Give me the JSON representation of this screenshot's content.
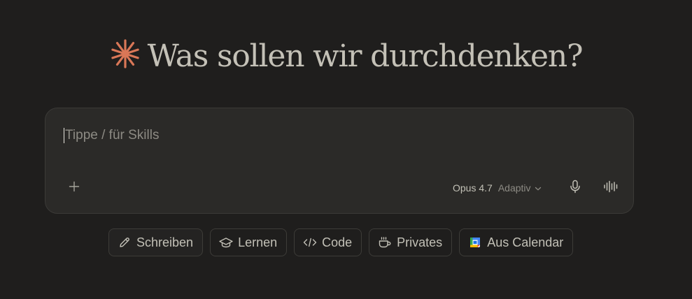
{
  "greeting": {
    "text": "Was sollen wir durchdenken?",
    "icon": "spark-icon",
    "icon_color": "#d97757"
  },
  "composer": {
    "placeholder": "Tippe / für Skills",
    "add_icon": "plus-icon",
    "model": {
      "name": "Opus 4.7",
      "mode": "Adaptiv",
      "icon": "chevron-down-icon"
    },
    "dictation_icon": "microphone-icon",
    "voice_icon": "voice-waveform-icon"
  },
  "chips": [
    {
      "label": "Schreiben",
      "icon": "pencil-icon"
    },
    {
      "label": "Lernen",
      "icon": "graduation-cap-icon"
    },
    {
      "label": "Code",
      "icon": "code-icon"
    },
    {
      "label": "Privates",
      "icon": "coffee-cup-icon"
    },
    {
      "label": "Aus Calendar",
      "icon": "google-calendar-icon"
    }
  ],
  "colors": {
    "background": "#1f1e1d",
    "composer_bg": "#2b2a28",
    "accent": "#d97757"
  }
}
